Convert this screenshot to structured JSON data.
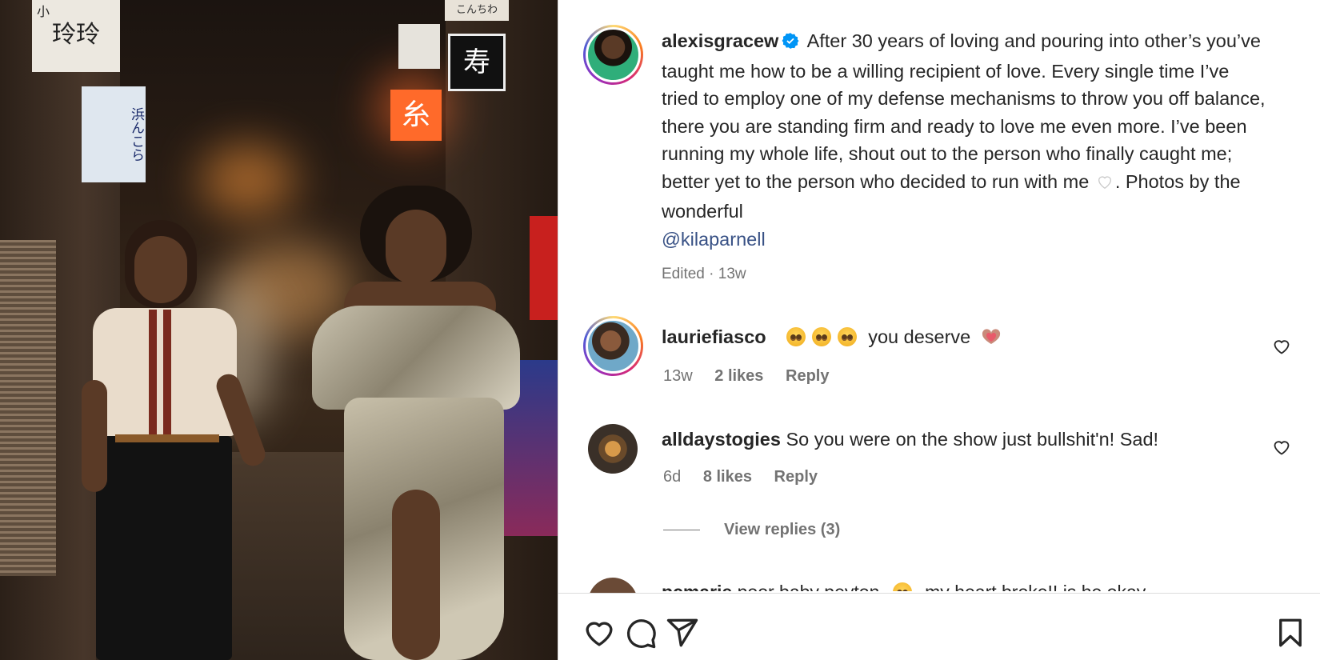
{
  "post": {
    "username": "alexisgracew",
    "caption": "After 30 years of loving and pouring into other’s you’ve taught me how to be a willing recipient of love. Every single time I’ve tried to employ one of my defense mechanisms to throw you off balance, there you are standing firm and ready to love me even more. I’ve been running my whole life, shout out to the person who finally caught me; better yet to the person who decided to run with me",
    "caption_after_heart": ". Photos by the wonderful",
    "mention": "@kilaparnell",
    "edited_label": "Edited",
    "separator": "·",
    "time": "13w",
    "icons": [
      "verified-badge-icon",
      "white-heart-emoji-icon"
    ]
  },
  "photo_signs": {
    "sign1": "小",
    "sign2": "玲玲",
    "sign3": "糸",
    "sign4": "浜んこら",
    "sign5": "こんちわ"
  },
  "comments": [
    {
      "username": "lauriefiasco",
      "text": "you deserve",
      "emojis": [
        "pleading-face-emoji",
        "pleading-face-emoji",
        "pleading-face-emoji",
        "heart-hands-emoji"
      ],
      "time": "13w",
      "likes": "2 likes",
      "reply": "Reply"
    },
    {
      "username": "alldaystogies",
      "text": "So you were on the show just bullshit'n! Sad!",
      "time": "6d",
      "likes": "8 likes",
      "reply": "Reply",
      "view_replies": "View replies (3)"
    },
    {
      "username": "pcmarie",
      "text": "poor baby peyton",
      "text2": "my heart broke!! is he okay"
    }
  ],
  "actions": [
    "like-icon",
    "comment-icon",
    "share-icon",
    "save-icon"
  ],
  "colors": {
    "text": "#262626",
    "muted": "#737373",
    "mention": "#385185",
    "verified": "#0095f6",
    "border": "#dbdbdb"
  }
}
